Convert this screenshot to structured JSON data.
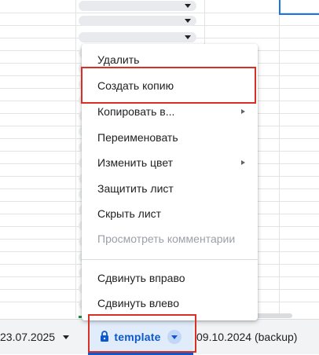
{
  "context_menu": {
    "items": [
      {
        "label": "Удалить",
        "submenu": false,
        "disabled": false
      },
      {
        "label": "Создать копию",
        "submenu": false,
        "disabled": false
      },
      {
        "label": "Копировать в...",
        "submenu": true,
        "disabled": false
      },
      {
        "label": "Переименовать",
        "submenu": false,
        "disabled": false
      },
      {
        "label": "Изменить цвет",
        "submenu": true,
        "disabled": false
      },
      {
        "label": "Защитить лист",
        "submenu": false,
        "disabled": false
      },
      {
        "label": "Скрыть лист",
        "submenu": false,
        "disabled": false
      },
      {
        "label": "Просмотреть комментарии",
        "submenu": false,
        "disabled": true
      },
      {
        "label": "Сдвинуть вправо",
        "submenu": false,
        "disabled": false
      },
      {
        "label": "Сдвинуть влево",
        "submenu": false,
        "disabled": false
      }
    ]
  },
  "sheet_tabs": {
    "left": {
      "label": "23.07.2025"
    },
    "active": {
      "label": "template",
      "icon": "lock-icon"
    },
    "right": {
      "label": "09.10.2024 (backup)"
    }
  },
  "colors": {
    "accent": "#0b57d0",
    "highlight": "#d93025",
    "tab_bar": "#f1f3f4"
  }
}
